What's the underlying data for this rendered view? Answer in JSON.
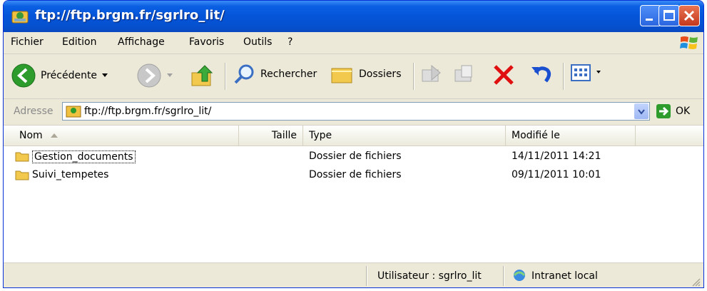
{
  "window": {
    "title": "ftp://ftp.brgm.fr/sgrlro_lit/"
  },
  "menu": [
    "Fichier",
    "Edition",
    "Affichage",
    "Favoris",
    "Outils",
    "?"
  ],
  "toolbar": {
    "back": "Précédente",
    "search": "Rechercher",
    "folders": "Dossiers"
  },
  "address": {
    "label": "Adresse",
    "value": "ftp://ftp.brgm.fr/sgrlro_lit/",
    "go": "OK"
  },
  "columns": {
    "name": "Nom",
    "size": "Taille",
    "type": "Type",
    "modified": "Modifié le"
  },
  "files": [
    {
      "name": "Gestion_documents",
      "size": "",
      "type": "Dossier de fichiers",
      "modified": "14/11/2011 14:21"
    },
    {
      "name": "Suivi_tempetes",
      "size": "",
      "type": "Dossier de fichiers",
      "modified": "09/11/2011 10:01"
    }
  ],
  "status": {
    "user": "Utilisateur : sgrlro_lit",
    "zone": "Intranet local"
  },
  "colors": {
    "titlebar": "#0554d8",
    "accent_green": "#2d9c2d",
    "delete_red": "#e01010"
  }
}
